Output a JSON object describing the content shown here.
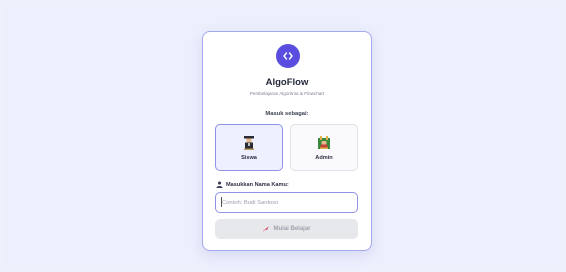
{
  "app": {
    "name": "AlgoFlow",
    "tagline": "Pembelajaran Algoritma & Flowchart"
  },
  "login": {
    "prompt": "Masuk sebagai:",
    "roles": [
      {
        "label": "Siswa",
        "icon": "student-icon",
        "selected": true
      },
      {
        "label": "Admin",
        "icon": "admin-icon",
        "selected": false
      }
    ],
    "name_label": "Masukkan Nama Kamu:",
    "name_placeholder": "Contoh: Budi Santoso",
    "name_value": "",
    "start_label": "Mulai Belajar",
    "start_enabled": false
  },
  "colors": {
    "accent": "#5b4de0",
    "card_border": "#a5a9ee",
    "selected_bg": "#eef0ff",
    "disabled_button": "#e7e8ec"
  }
}
